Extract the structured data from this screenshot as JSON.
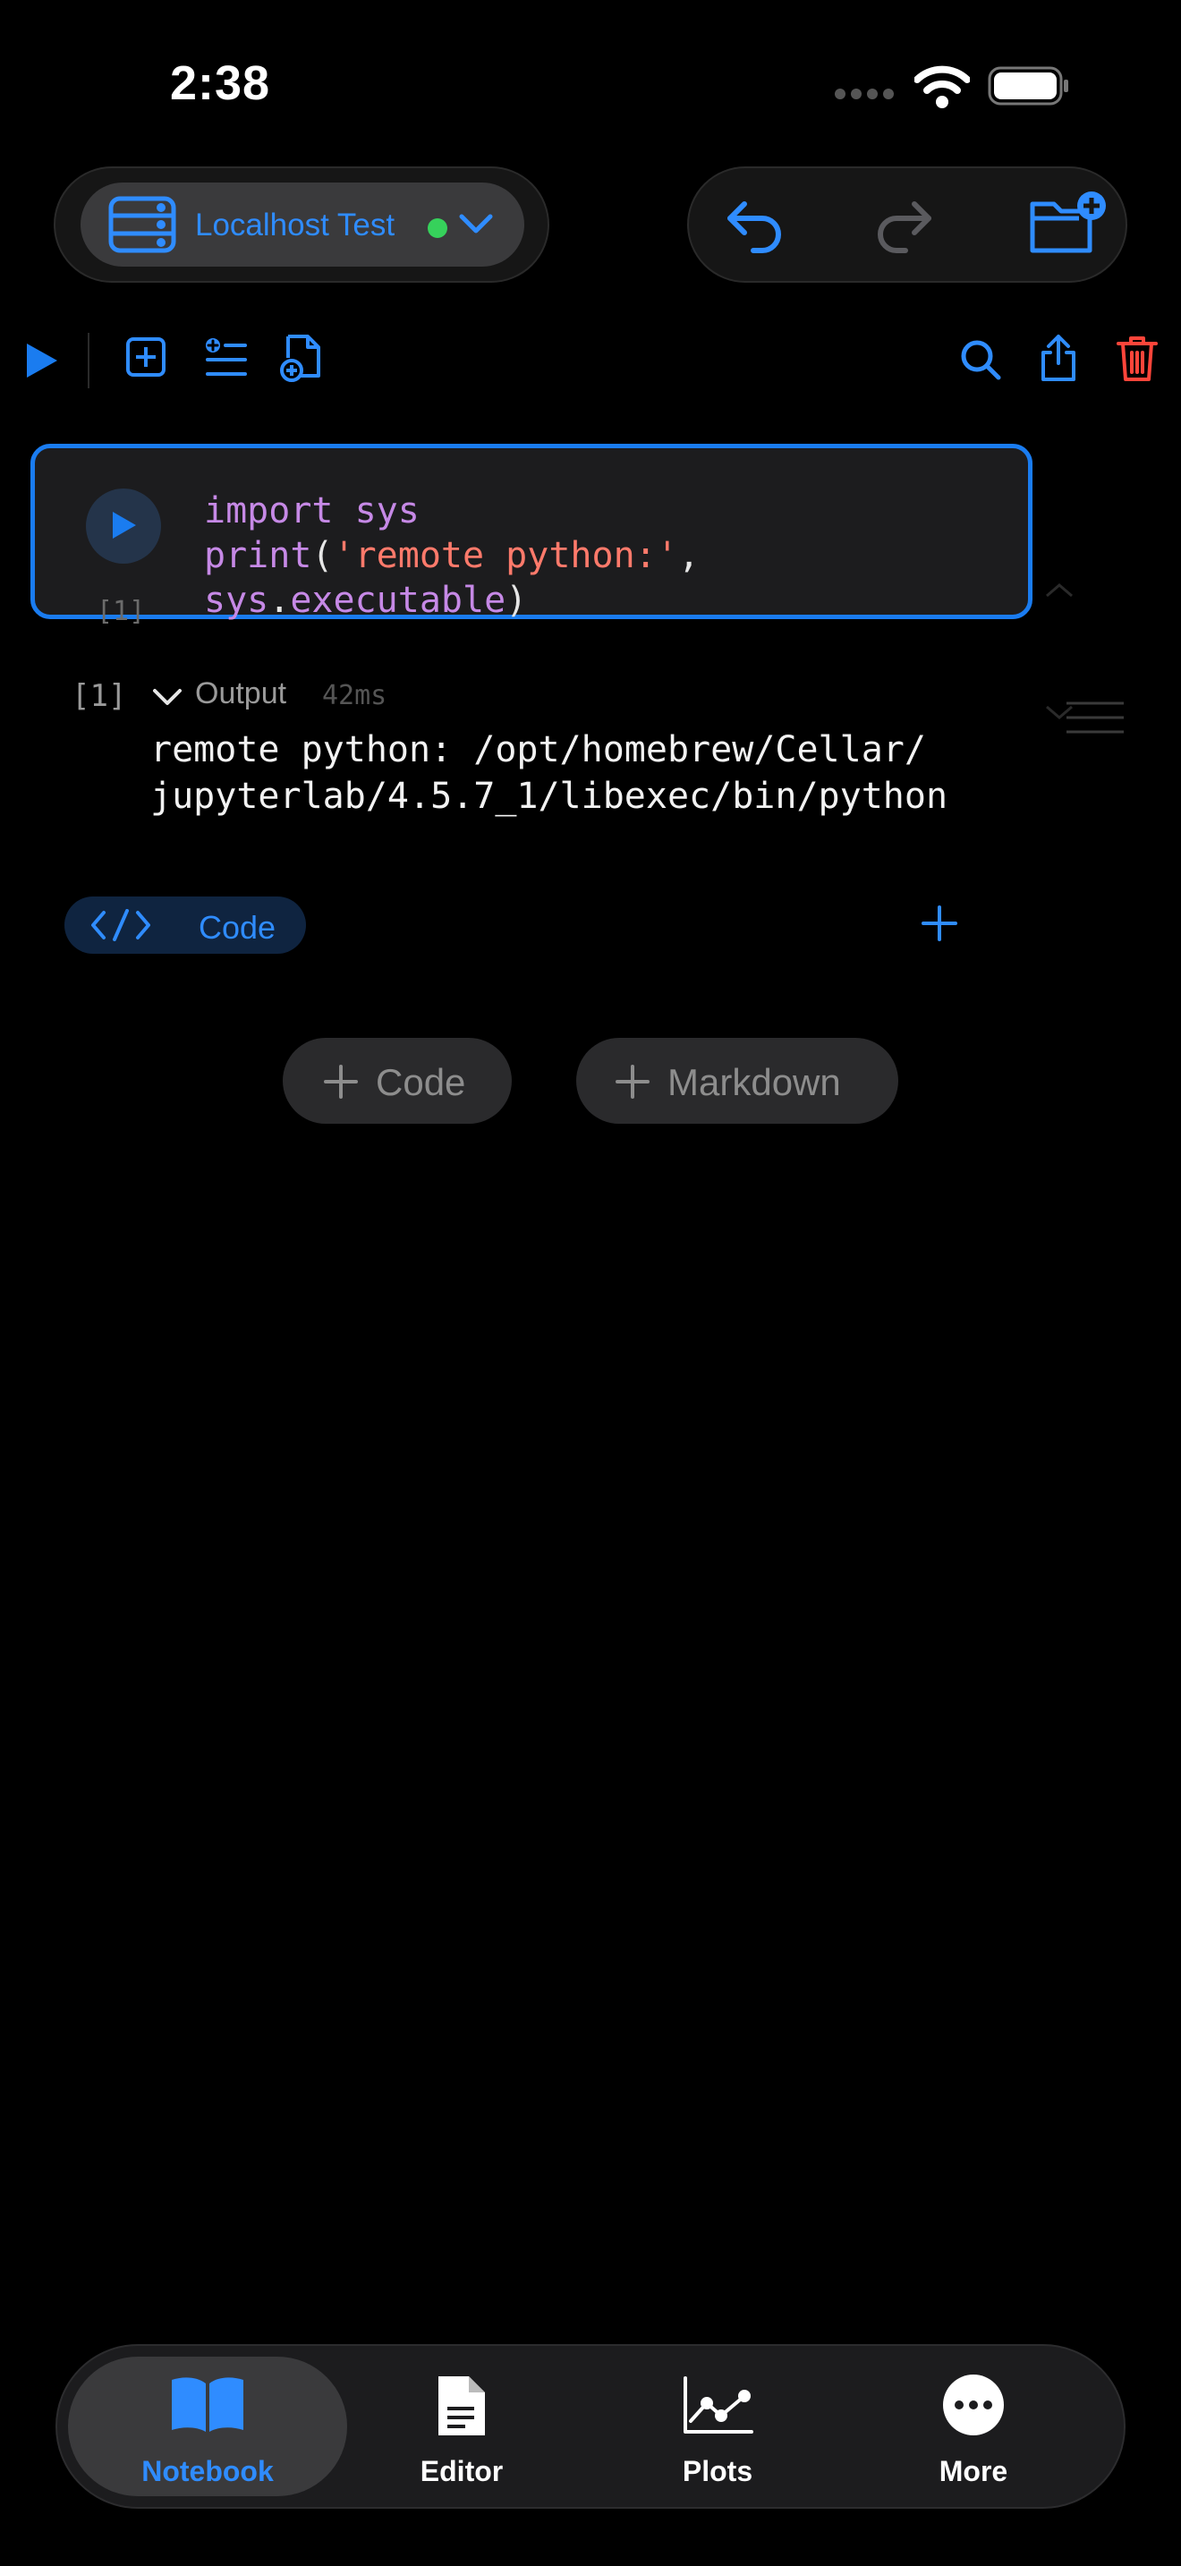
{
  "status_bar": {
    "time": "2:38"
  },
  "kernel": {
    "name": "Localhost Test",
    "status_color": "#36d15b"
  },
  "colors": {
    "accent": "#2f8cff",
    "danger": "#ff453a",
    "keyword": "#c689e6",
    "string": "#ff7a6b"
  },
  "toolbar": {
    "left": [
      "run-icon",
      "add-cell-icon",
      "insert-below-icon",
      "new-file-icon"
    ],
    "right": [
      "search-icon",
      "share-icon",
      "trash-icon"
    ]
  },
  "cell": {
    "execution_count": "[1]",
    "code": {
      "l1_kw": "import",
      "l1_rest": " sys",
      "l2_fn": "print",
      "l2_open": "(",
      "l2_str": "'remote python:'",
      "l2_comma": ",",
      "l3_obj": "sys",
      "l3_dot": ".",
      "l3_attr": "executable",
      "l3_close": ")"
    }
  },
  "output": {
    "count": "[1]",
    "label": "Output",
    "duration": "42ms",
    "text": "remote python: /opt/homebrew/Cellar/\njupyterlab/4.5.7_1/libexec/bin/python"
  },
  "cell_type": {
    "label": "Code"
  },
  "add_buttons": {
    "code": "Code",
    "markdown": "Markdown"
  },
  "tabs": [
    {
      "label": "Notebook",
      "icon": "book-icon",
      "active": true
    },
    {
      "label": "Editor",
      "icon": "document-icon",
      "active": false
    },
    {
      "label": "Plots",
      "icon": "chart-icon",
      "active": false
    },
    {
      "label": "More",
      "icon": "ellipsis-icon",
      "active": false
    }
  ]
}
